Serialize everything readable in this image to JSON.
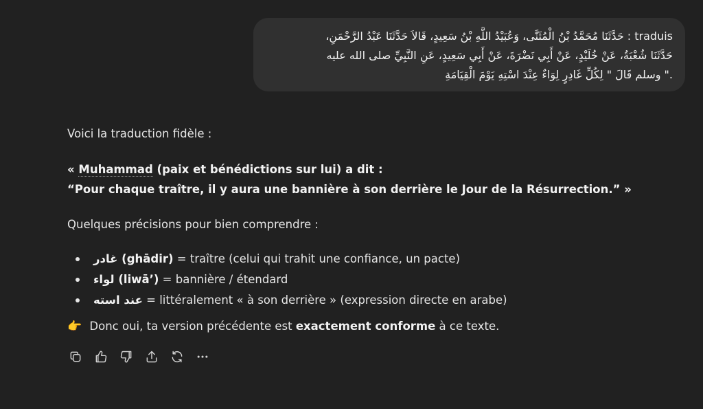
{
  "user_message": {
    "line1": "traduis : حَدَّثَنَا مُحَمَّدُ بْنُ الْمُثَنَّى، وَعُبَيْدُ اللَّهِ بْنُ سَعِيدٍ، قَالاَ حَدَّثَنَا عَبْدُ الرَّحْمَنِ،",
    "line2": "حَدَّثَنَا شُعْبَةُ، عَنْ خُلَيْدٍ، عَنْ أَبِي نَضْرَةَ، عَنْ أَبِي سَعِيدٍ، عَنِ النَّبِيِّ صلى الله عليه",
    "line3": ".\" وسلم قَالَ \" لِكُلِّ غَادِرٍ لِوَاءٌ عِنْدَ اسْتِهِ يَوْمَ الْقِيَامَةِ"
  },
  "assistant": {
    "intro": "Voici la traduction fidèle :",
    "quote_open": "« ",
    "quote_name": "Muhammad",
    "quote_line1_rest": " (paix et bénédictions sur lui) a dit :",
    "quote_line2": "“Pour chaque traître, il y aura une bannière à son derrière le Jour de la Résurrection.” »",
    "precisions_intro": "Quelques précisions pour bien comprendre :",
    "bullets": [
      {
        "term": "غادر (ghādir)",
        "def": " = traître (celui qui trahit une confiance, un pacte)"
      },
      {
        "term": "لواء (liwā’)",
        "def": " = bannière / étendard"
      },
      {
        "term": "عند استه",
        "def": " = littéralement « à son derrière » (expression directe en arabe)"
      }
    ],
    "conclusion_emoji": "👉",
    "conclusion_pre": " Donc oui, ta version précédente est ",
    "conclusion_bold": "exactement conforme",
    "conclusion_post": " à ce texte."
  },
  "actions": [
    {
      "icon": "copy-icon"
    },
    {
      "icon": "thumbs-up-icon"
    },
    {
      "icon": "thumbs-down-icon"
    },
    {
      "icon": "share-icon"
    },
    {
      "icon": "regenerate-icon"
    },
    {
      "icon": "more-icon"
    }
  ],
  "colors": {
    "background": "#212121",
    "bubble": "#303030",
    "text": "#ececec"
  }
}
